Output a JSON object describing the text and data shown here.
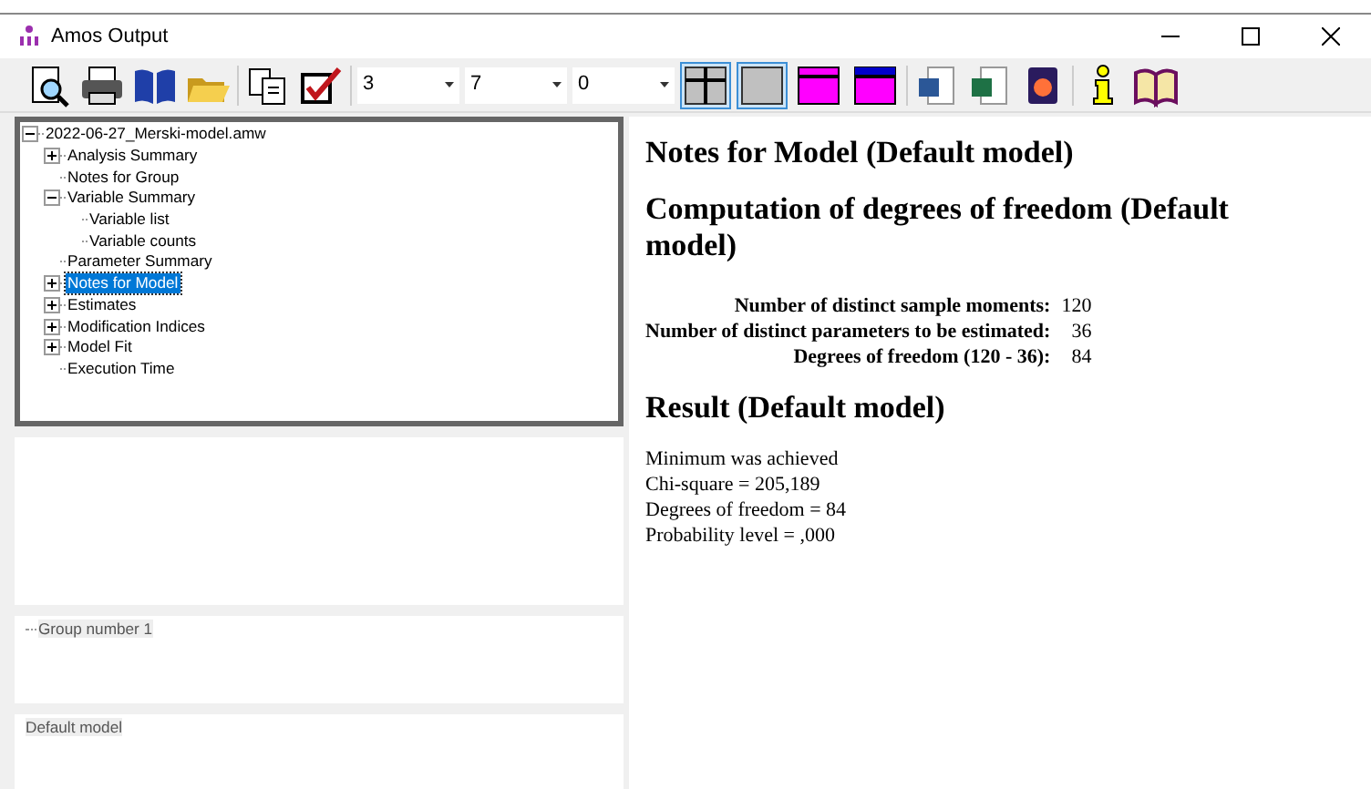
{
  "window": {
    "title": "Amos Output"
  },
  "toolbar": {
    "dropdowns": [
      {
        "value": "3"
      },
      {
        "value": "7"
      },
      {
        "value": "0"
      }
    ],
    "view_toggles": [
      {
        "kind": "grid",
        "pressed": true
      },
      {
        "kind": "plain",
        "pressed": true
      },
      {
        "kind": "magenta-top",
        "pressed": false
      },
      {
        "kind": "blue-top",
        "pressed": false
      }
    ]
  },
  "tree": {
    "label": "2022-06-27_Merski-model.amw",
    "expanded": true,
    "children": [
      {
        "label": "Analysis Summary",
        "expanded": false,
        "selected": false
      },
      {
        "label": "Notes for Group",
        "selected": false
      },
      {
        "label": "Variable Summary",
        "expanded": true,
        "selected": false,
        "children": [
          {
            "label": "Variable list",
            "selected": false
          },
          {
            "label": "Variable counts",
            "selected": false
          }
        ]
      },
      {
        "label": "Parameter Summary",
        "selected": false
      },
      {
        "label": "Notes for Model",
        "expanded": false,
        "selected": true
      },
      {
        "label": "Estimates",
        "expanded": false,
        "selected": false
      },
      {
        "label": "Modification Indices",
        "expanded": false,
        "selected": false
      },
      {
        "label": "Model Fit",
        "expanded": false,
        "selected": false
      },
      {
        "label": "Execution Time",
        "selected": false
      }
    ]
  },
  "groups": [
    {
      "label": "Group number 1"
    }
  ],
  "models": [
    {
      "label": "Default model"
    }
  ],
  "output": {
    "title": "Notes for Model (Default model)",
    "section": "Computation of degrees of freedom (Default model)",
    "rows": [
      {
        "label": "Number of distinct sample moments:",
        "value": "120"
      },
      {
        "label": "Number of distinct parameters to be estimated:",
        "value": "36"
      },
      {
        "label": "Degrees of freedom (120 - 36):",
        "value": "84"
      }
    ],
    "result_title": "Result (Default model)",
    "result_lines": [
      "Minimum was achieved",
      "Chi-square = 205,189",
      "Degrees of freedom = 84",
      "Probability level = ,000"
    ]
  }
}
